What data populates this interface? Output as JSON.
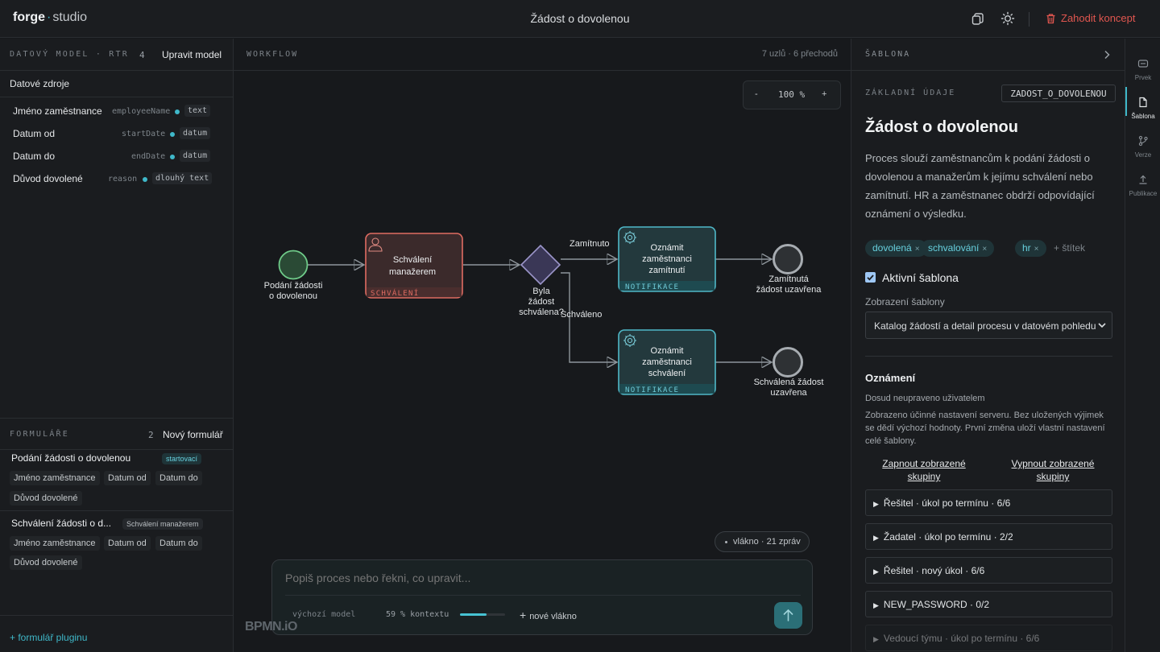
{
  "app": {
    "brand_a": "forge",
    "brand_dot": "·",
    "brand_b": "studio",
    "title": "Žádost o dovolenou",
    "discard": "Zahodit koncept"
  },
  "left": {
    "model_label": "DATOVÝ MODEL · RTR",
    "model_count": "4",
    "model_action": "Upravit model",
    "sources_label": "Datové zdroje",
    "fields": [
      {
        "label": "Jméno zaměstnance",
        "key": "employeeName",
        "type": "text"
      },
      {
        "label": "Datum od",
        "key": "startDate",
        "type": "datum"
      },
      {
        "label": "Datum do",
        "key": "endDate",
        "type": "datum"
      },
      {
        "label": "Důvod dovolené",
        "key": "reason",
        "type": "dlouhý text"
      }
    ],
    "forms_label": "FORMULÁŘE",
    "forms_count": "2",
    "forms_action": "Nový formulář",
    "forms": [
      {
        "title": "Podání žádosti o dovolenou",
        "badge": "startovací",
        "chips": [
          "Jméno zaměstnance",
          "Datum od",
          "Datum do",
          "Důvod dovolené"
        ]
      },
      {
        "title": "Schválení žádosti o d...",
        "badge": "Schválení manažerem",
        "chips": [
          "Jméno zaměstnance",
          "Datum od",
          "Datum do",
          "Důvod dovolené"
        ]
      }
    ],
    "plugin_link": "+ formulář pluginu"
  },
  "canvas": {
    "label": "WORKFLOW",
    "stats": "7 uzlů · 6 přechodů",
    "zoom": {
      "minus": "-",
      "value": "100 %",
      "plus": "+"
    },
    "nodes": {
      "start": "Podání žádosti o dovolenou",
      "approve_task": "Schválení manažerem",
      "approve_tag": "SCHVÁLENÍ",
      "gateway": "Byla žádost schválena?",
      "notify_reject": "Oznámit zaměstnanci zamítnutí",
      "notify_approve": "Oznámit zaměstnanci schválení",
      "notify_tag": "NOTIFIKACE",
      "end_reject": "Zamítnutá žádost uzavřena",
      "end_approve": "Schválená žádost uzavřena",
      "edge_reject": "Zamítnuto",
      "edge_approve": "Schváleno"
    },
    "thread_pill": "vlákno · 21 zpráv",
    "chat": {
      "placeholder": "Popiš proces nebo řekni, co upravit...",
      "model": "výchozí model",
      "context": "59 % kontextu",
      "context_fraction": 0.59,
      "new_thread": "nové vlákno"
    },
    "bpmn_logo": "BPMN.iO"
  },
  "right": {
    "label": "ŠABLONA",
    "section": "ZÁKLADNÍ ÚDAJE",
    "code": "ZADOST_O_DOVOLENOU",
    "title": "Žádost o dovolenou",
    "description": "Proces slouží zaměstnancům k podání žádosti o dovolenou a manažerům k jejímu schválení nebo zamítnutí. HR a zaměstnanec obdrží odpovídající oznámení o výsledku.",
    "tags": [
      "dovolená",
      "schvalování",
      "hr"
    ],
    "tag_remove": "×",
    "add_tag": "+ štítek",
    "active_label": "Aktivní šablona",
    "display_label": "Zobrazení šablony",
    "display_value": "Katalog žádostí a detail procesu v datovém pohledu",
    "notif_title": "Oznámení",
    "notif_state": "Dosud neupraveno uživatelem",
    "notif_desc": "Zobrazeno účinné nastavení serveru. Bez uložených výjimek se dědí výchozí hodnoty. První změna uloží vlastní nastavení celé šablony.",
    "enable_link": "Zapnout zobrazené skupiny",
    "disable_link": "Vypnout zobrazené skupiny",
    "groups": [
      "Řešitel · úkol po termínu · 6/6",
      "Žadatel · úkol po termínu · 2/2",
      "Řešitel · nový úkol · 6/6",
      "NEW_PASSWORD · 0/2",
      "Vedoucí týmu · úkol po termínu · 6/6"
    ]
  },
  "rail": {
    "items": [
      "Prvek",
      "Šablona",
      "Verze",
      "Publikace"
    ]
  }
}
